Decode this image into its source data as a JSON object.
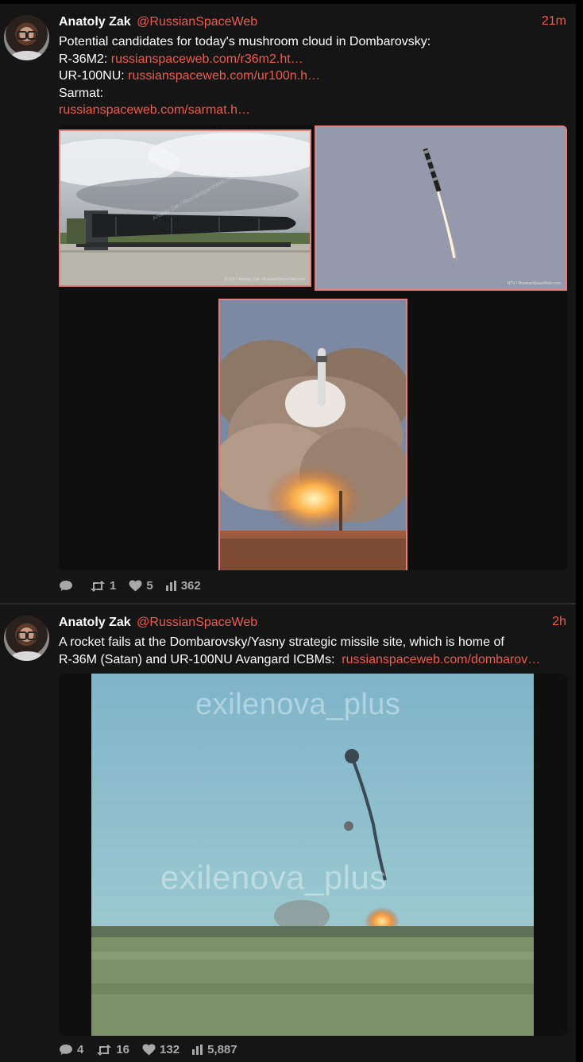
{
  "tweets": [
    {
      "author": "Anatoly Zak",
      "handle": "@RussianSpaceWeb",
      "time": "21m",
      "lines": [
        {
          "prefix": "Potential candidates for today's mushroom cloud in Dombarovsky:",
          "link": ""
        },
        {
          "prefix": "R-36M2: ",
          "link": "russianspaceweb.com/r36m2.ht…"
        },
        {
          "prefix": "UR-100NU: ",
          "link": "russianspaceweb.com/ur100n.h…"
        },
        {
          "prefix": "Sarmat:",
          "link": ""
        },
        {
          "prefix": "",
          "link": "russianspaceweb.com/sarmat.h…"
        }
      ],
      "images": [
        {
          "credit": "© 2017 Anatoly Zak / RussianSpaceWeb.com",
          "watermark": "Anatoly Zak / RussianSpaceWeb.com"
        },
        {
          "credit": "NTV / RussianSpaceWeb.com"
        },
        {
          "credit": ""
        }
      ],
      "stats": {
        "replies": "",
        "retweets": "1",
        "likes": "5",
        "views": "362"
      }
    },
    {
      "author": "Anatoly Zak",
      "handle": "@RussianSpaceWeb",
      "time": "2h",
      "text_line1": "A rocket fails at the Dombarovsky/Yasny strategic missile site, which is home of",
      "text_line2": "R-36M (Satan) and UR-100NU Avangard ICBMs:  ",
      "link": "russianspaceweb.com/dombarov…",
      "video_watermark": "exilenova_plus",
      "stats": {
        "replies": "4",
        "retweets": "16",
        "likes": "132",
        "views": "5,887"
      }
    }
  ],
  "colors": {
    "link": "#ee5b4f",
    "image_border": "#e87f7f",
    "background": "#151515"
  },
  "icons": [
    "reply-icon",
    "retweet-icon",
    "like-icon",
    "views-icon"
  ]
}
